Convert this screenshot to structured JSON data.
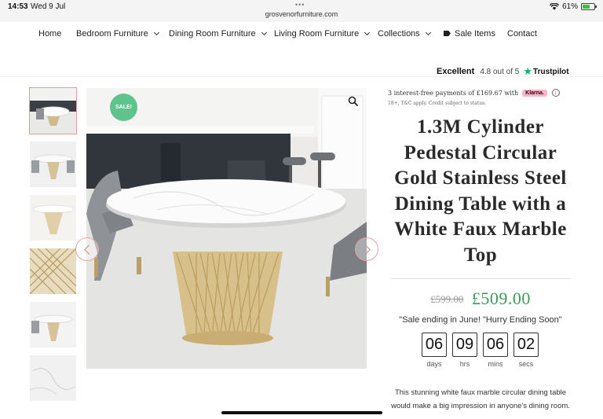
{
  "status_bar": {
    "time": "14:53",
    "date": "Wed 9 Jul",
    "url": "grosvenorfurniture.com",
    "battery": "61%",
    "battery_level": 0.61
  },
  "nav": {
    "items": [
      {
        "label": "Home",
        "dropdown": false
      },
      {
        "label": "Bedroom Furniture",
        "dropdown": true
      },
      {
        "label": "Dining Room Furniture",
        "dropdown": true
      },
      {
        "label": "Living Room Furniture",
        "dropdown": true
      },
      {
        "label": "Collections",
        "dropdown": true
      },
      {
        "label": "Sale Items",
        "dropdown": false,
        "icon": "tag-icon"
      },
      {
        "label": "Contact",
        "dropdown": false
      }
    ]
  },
  "trustpilot": {
    "rating_word": "Excellent",
    "score_text": "4.8 out of 5",
    "brand": "Trustpilot",
    "star_color": "#00b67a"
  },
  "gallery": {
    "sale_badge": "SALE!",
    "thumbnail_count": 6,
    "active_thumbnail": 1
  },
  "klarna": {
    "text": "3 interest-free payments of £169.67 with",
    "badge": "Klarna.",
    "terms": "18+, T&C apply. Credit subject to status."
  },
  "product": {
    "title": "1.3M Cylinder Pedestal Circular Gold Stainless Steel Dining Table with a White Faux Marble Top",
    "old_price": "£599.00",
    "price": "£509.00",
    "price_color": "#3f9a5a",
    "promo": "\"Sale ending in June! \"Hurry Ending Soon\"",
    "description": "This stunning white faux marble circular dining table would make a big impression in anyone's dining room."
  },
  "countdown": [
    {
      "value": "06",
      "label": "days"
    },
    {
      "value": "09",
      "label": "hrs"
    },
    {
      "value": "06",
      "label": "mins"
    },
    {
      "value": "02",
      "label": "secs"
    }
  ]
}
